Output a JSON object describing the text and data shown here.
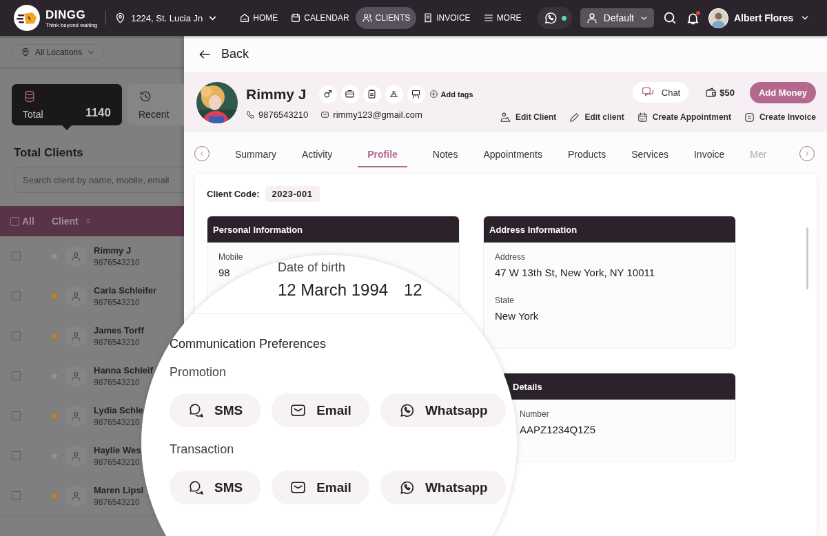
{
  "topbar": {
    "brand": "DINGG",
    "tagline": "Think beyond waiting",
    "location": "1224, St. Lucia Jn",
    "nav": [
      {
        "label": "HOME",
        "selected": false
      },
      {
        "label": "CALENDAR",
        "selected": false
      },
      {
        "label": "CLIENTS",
        "selected": true
      },
      {
        "label": "INVOICE",
        "selected": false
      },
      {
        "label": "MORE",
        "selected": false
      }
    ],
    "profile_menu": "Default",
    "user": "Albert Flores"
  },
  "sidebar": {
    "location_filter": "All Locations",
    "stats": [
      {
        "label": "Total",
        "count": "1140",
        "selected": true
      },
      {
        "label": "Recent",
        "selected": false
      }
    ],
    "title": "Total Clients",
    "search": {
      "placeholder": "Search client by name, mobile, email"
    },
    "table": {
      "select_all": {
        "label": "All",
        "checked": false
      },
      "column": "Client",
      "rows": [
        {
          "name": "Rimmy J",
          "phone": "9876543210",
          "starred": false,
          "checked": false
        },
        {
          "name": "Carla Schleifer",
          "phone": "9876543210",
          "starred": true,
          "checked": false
        },
        {
          "name": "James Torff",
          "phone": "9876543210",
          "starred": true,
          "checked": false
        },
        {
          "name": "Hanna Schleif",
          "phone": "9876543210",
          "starred": false,
          "checked": false
        },
        {
          "name": "Lydia Schle",
          "phone": "9876543210",
          "starred": true,
          "checked": false
        },
        {
          "name": "Haylie Wes",
          "phone": "9876543210",
          "starred": false,
          "checked": false
        },
        {
          "name": "Maren Lipsl",
          "phone": "9876543210",
          "starred": true,
          "checked": false
        }
      ]
    }
  },
  "back": "Back",
  "client": {
    "name": "Rimmy J",
    "phone": "9876543210",
    "email": "rimmy123@gmail.com",
    "add_tags": "Add tags",
    "chat": "Chat",
    "wallet": "$50",
    "add_money": "Add Money",
    "actions": [
      "Edit Client",
      "Edit client",
      "Create Appointment",
      "Create Invoice"
    ]
  },
  "tabs": [
    {
      "label": "Summary",
      "selected": false
    },
    {
      "label": "Activity",
      "selected": false
    },
    {
      "label": "Profile",
      "selected": true
    },
    {
      "label": "Notes",
      "selected": false
    },
    {
      "label": "Appointments",
      "selected": false
    },
    {
      "label": "Products",
      "selected": false
    },
    {
      "label": "Services",
      "selected": false
    },
    {
      "label": "Invoice",
      "selected": false
    },
    {
      "label": "Mer",
      "selected": false
    }
  ],
  "profile": {
    "client_code_label": "Client Code:",
    "client_code": "2023-001",
    "cards": [
      {
        "title": "Personal Information",
        "fields": [
          {
            "label": "Mobile",
            "value": "98"
          }
        ]
      },
      {
        "title": "Address Information",
        "fields": [
          {
            "label": "Address",
            "value": "47 W 13th St, New York, NY 10011"
          },
          {
            "label": "State",
            "value": "New York"
          }
        ]
      },
      {
        "title": "Details",
        "fields": [
          {
            "label": "Number",
            "value": "AAPZ1234Q1Z5"
          }
        ]
      }
    ]
  },
  "magnifier": {
    "dob_label": "Date of birth",
    "dob": "12 March 1994",
    "next_value": "12",
    "section": "Communication Preferences",
    "groups": [
      {
        "label": "Promotion",
        "channels": [
          "SMS",
          "Email",
          "Whatsapp"
        ]
      },
      {
        "label": "Transaction",
        "channels": [
          "SMS",
          "Email",
          "Whatsapp"
        ]
      }
    ]
  }
}
